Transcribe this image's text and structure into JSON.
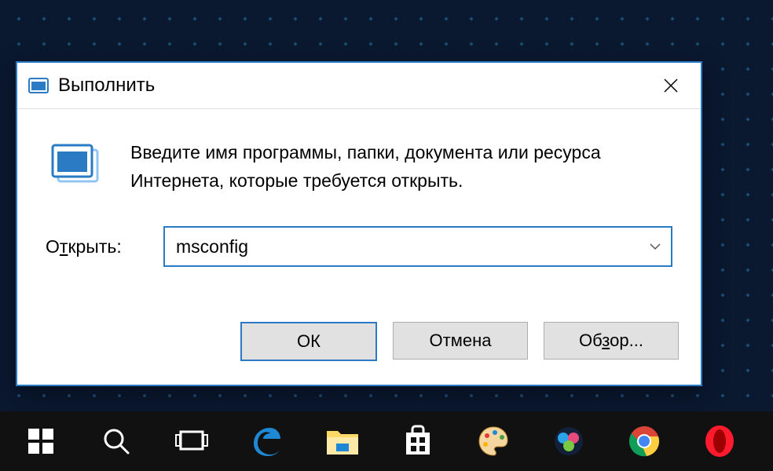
{
  "dialog": {
    "title": "Выполнить",
    "instructions": "Введите имя программы, папки, документа или ресурса Интернета, которые требуется открыть.",
    "open_label_pre": "О",
    "open_label_u": "т",
    "open_label_post": "крыть:",
    "input_value": "msconfig",
    "buttons": {
      "ok": "ОК",
      "cancel": "Отмена",
      "browse_pre": "Об",
      "browse_u": "з",
      "browse_post": "ор..."
    }
  },
  "taskbar": {
    "items": [
      {
        "name": "start"
      },
      {
        "name": "search"
      },
      {
        "name": "task-view"
      },
      {
        "name": "edge"
      },
      {
        "name": "file-explorer"
      },
      {
        "name": "store"
      },
      {
        "name": "paint"
      },
      {
        "name": "paintnet"
      },
      {
        "name": "chrome"
      },
      {
        "name": "opera"
      }
    ]
  }
}
